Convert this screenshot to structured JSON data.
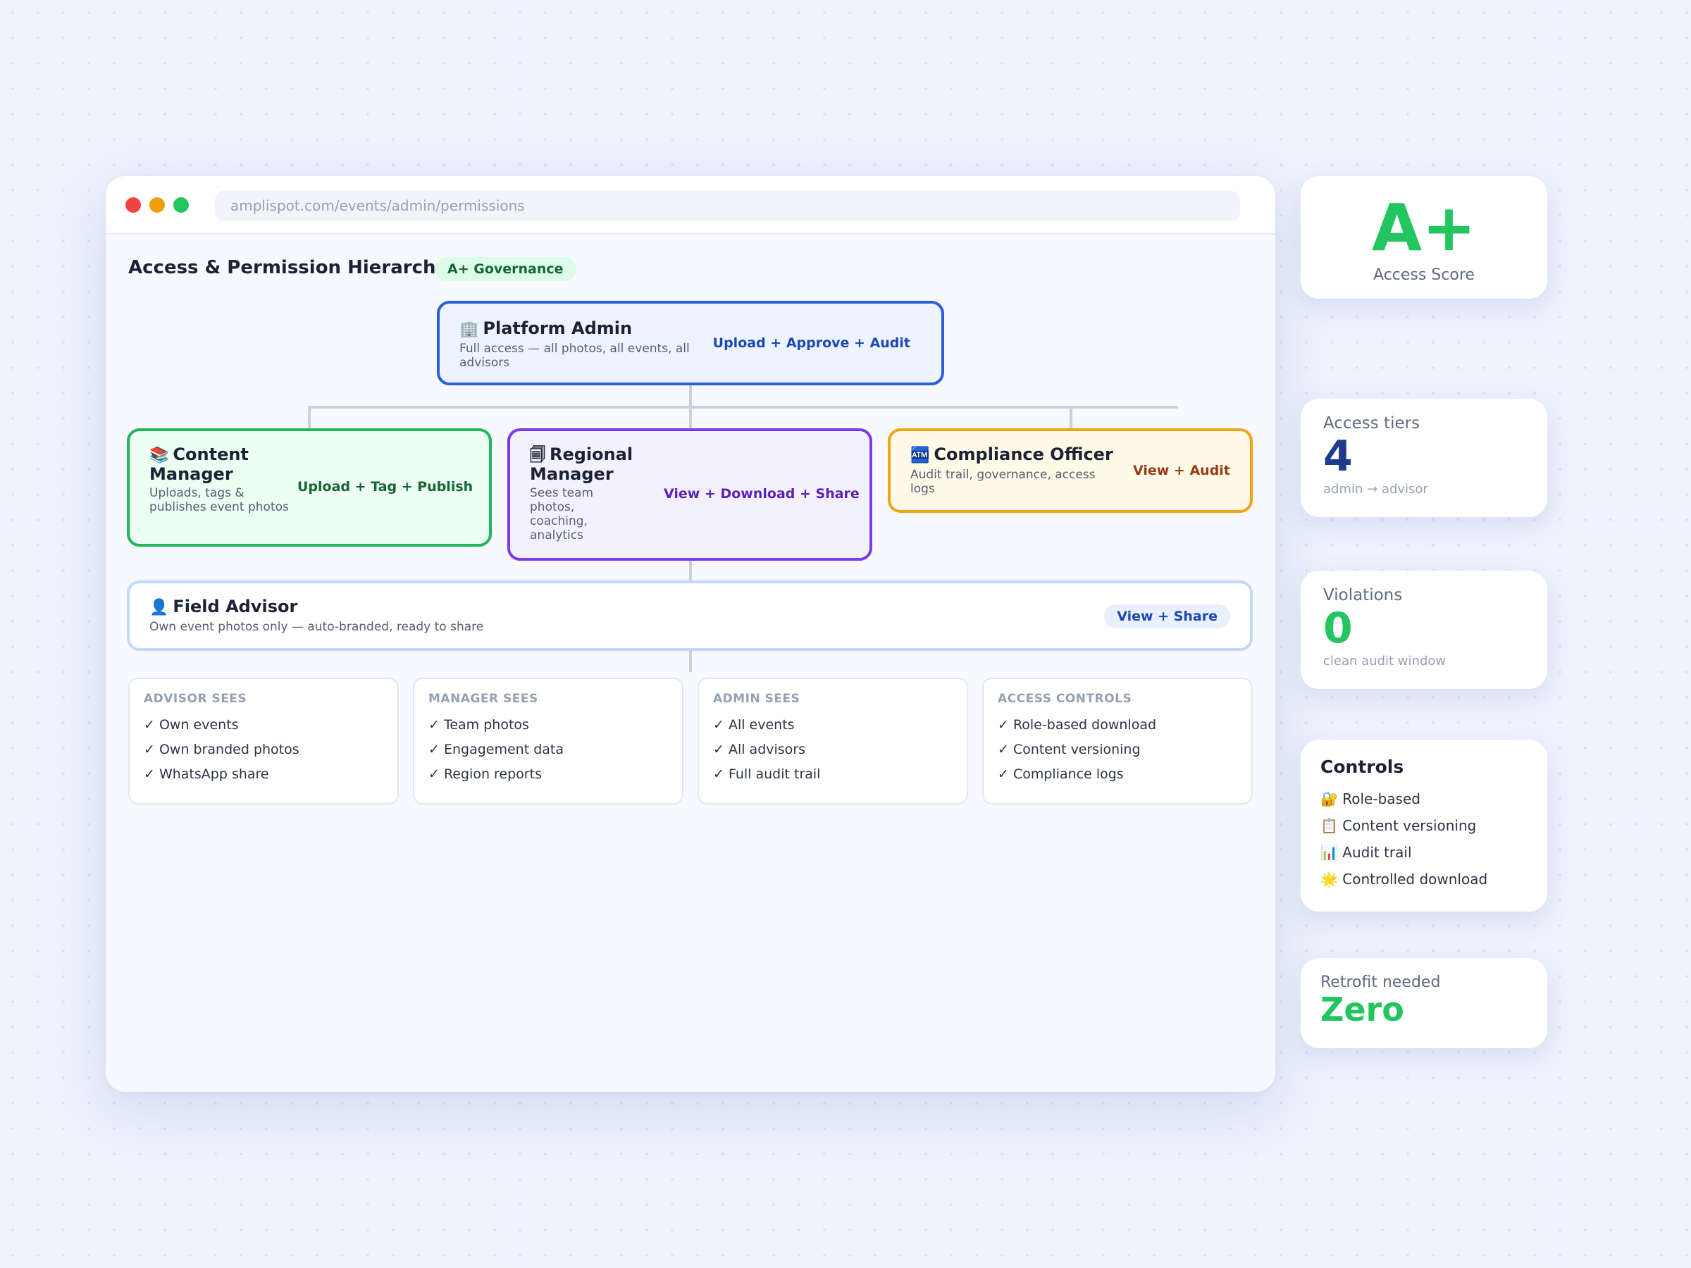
{
  "browser": {
    "url": "amplispot.com/events/admin/permissions"
  },
  "header": {
    "title": "Access & Permission Hierarchy",
    "badge": "A+ Governance"
  },
  "roles": {
    "admin": {
      "icon": "🏢",
      "title": "Platform Admin",
      "desc": "Full access — all photos, all events, all advisors",
      "perm": "Upload + Approve + Audit"
    },
    "content_manager": {
      "icon": "📚",
      "title": "Content Manager",
      "desc": "Uploads, tags & publishes event photos",
      "perm": "Upload + Tag + Publish"
    },
    "regional_manager": {
      "icon": "🗐",
      "title": "Regional Manager",
      "desc": "Sees team photos, coaching, analytics",
      "perm": "View + Download + Share"
    },
    "compliance_officer": {
      "icon": "🏧",
      "title": "Compliance Officer",
      "desc": "Audit trail, governance, access logs",
      "perm": "View + Audit"
    },
    "field_advisor": {
      "icon": "👤",
      "title": "Field Advisor",
      "desc": "Own event photos only — auto-branded, ready to share",
      "perm": "View + Share"
    }
  },
  "visibility": [
    {
      "title": "ADVISOR SEES",
      "items": [
        "✓ Own events",
        "✓ Own branded photos",
        "✓ WhatsApp share"
      ]
    },
    {
      "title": "MANAGER SEES",
      "items": [
        "✓ Team photos",
        "✓ Engagement data",
        "✓ Region reports"
      ]
    },
    {
      "title": "ADMIN SEES",
      "items": [
        "✓ All events",
        "✓ All advisors",
        "✓ Full audit trail"
      ]
    },
    {
      "title": "ACCESS CONTROLS",
      "items": [
        "✓ Role-based download",
        "✓ Content versioning",
        "✓ Compliance logs"
      ]
    }
  ],
  "score": {
    "grade": "A+",
    "label": "Access Score"
  },
  "tiers": {
    "label": "Access tiers",
    "value": "4",
    "sub": "admin → advisor"
  },
  "violations": {
    "label": "Violations",
    "value": "0",
    "sub": "clean audit window"
  },
  "controls": {
    "title": "Controls",
    "items": [
      "🔐 Role-based",
      "📋 Content versioning",
      "📊 Audit trail",
      "🌟 Controlled download"
    ]
  },
  "retrofit": {
    "label": "Retrofit needed",
    "value": "Zero"
  },
  "colors": {
    "admin_border": "#2760d6",
    "content_border": "#22b55a",
    "regional_border": "#7c3aed",
    "compliance_border": "#f0a416",
    "advisor_border": "#c5d8f8",
    "success": "#22c55e"
  }
}
